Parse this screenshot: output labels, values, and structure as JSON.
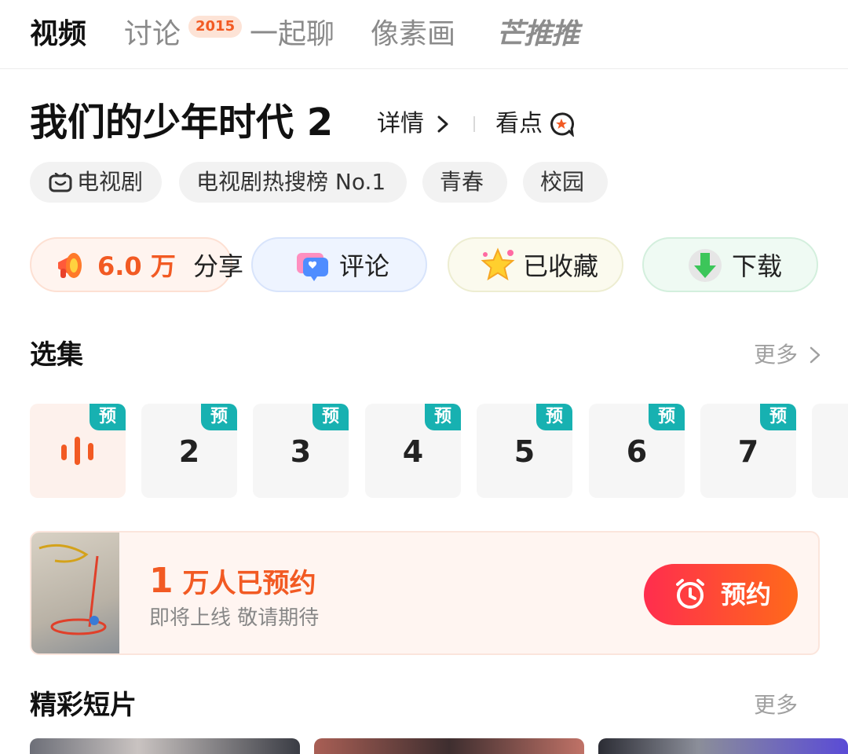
{
  "tabs": [
    {
      "label": "视频",
      "active": true
    },
    {
      "label": "讨论",
      "badge": "2015"
    },
    {
      "label": "一起聊"
    },
    {
      "label": "像素画"
    },
    {
      "label": "芒推推"
    }
  ],
  "show": {
    "title": "我们的少年时代 2",
    "detail_label": "详情",
    "highlight_label": "看点"
  },
  "tags": [
    "电视剧",
    "电视剧热搜榜 No.1",
    "青春",
    "校园"
  ],
  "actions": {
    "share_count": "6.0 万",
    "share_label": "分享",
    "comment_label": "评论",
    "favorite_label": "已收藏",
    "download_label": "下载"
  },
  "episodes": {
    "title": "选集",
    "more_label": "更多",
    "badge": "预",
    "items": [
      "",
      "2",
      "3",
      "4",
      "5",
      "6",
      "7"
    ]
  },
  "reserve": {
    "count_big": "1",
    "count_text": "万人已预约",
    "subtitle": "即将上线 敬请期待",
    "button_label": "预约"
  },
  "clips": {
    "title": "精彩短片",
    "more_label": "更多"
  },
  "colors": {
    "accent": "#f25a23",
    "teal_badge": "#17b1b1",
    "reserve_gradient_start": "#ff2d4e",
    "reserve_gradient_end": "#ff6a1a"
  }
}
